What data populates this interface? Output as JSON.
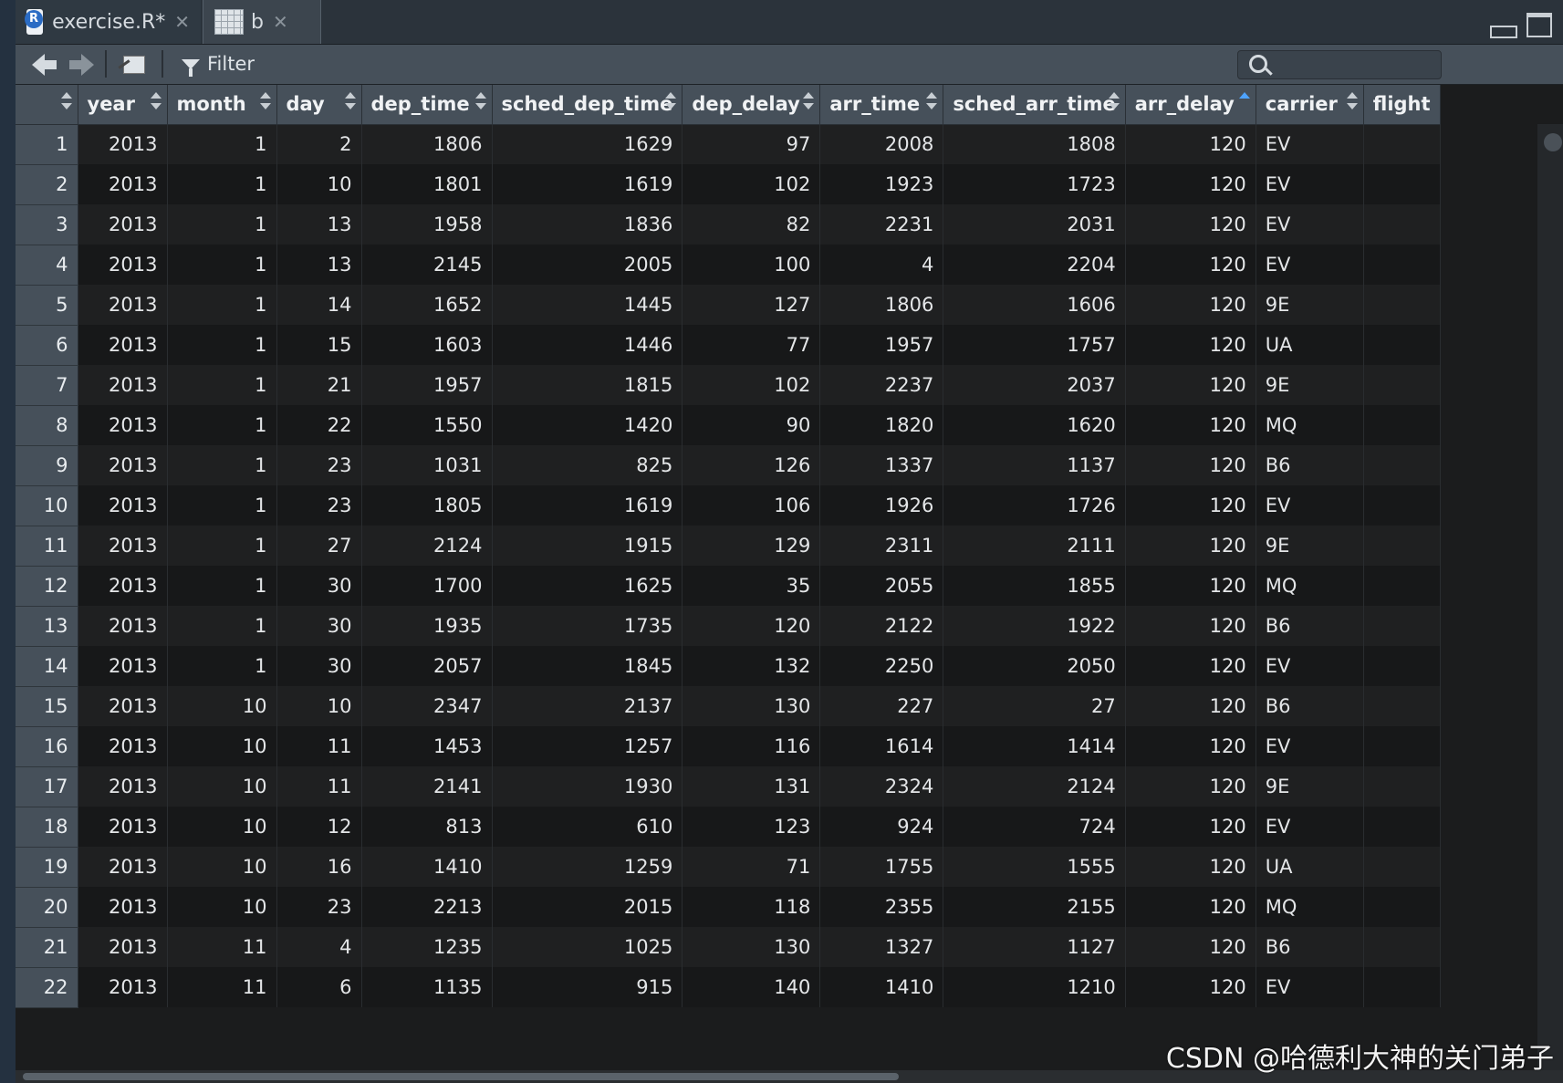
{
  "tabs": [
    {
      "label": "exercise.R*",
      "icon": "r-file-icon"
    },
    {
      "label": "b",
      "icon": "data-grid-icon"
    }
  ],
  "toolbar": {
    "filter_label": "Filter",
    "search_placeholder": ""
  },
  "table": {
    "columns": [
      "",
      "year",
      "month",
      "day",
      "dep_time",
      "sched_dep_time",
      "dep_delay",
      "arr_time",
      "sched_arr_time",
      "arr_delay",
      "carrier",
      "flight"
    ],
    "sorted_column": "arr_delay",
    "rows": [
      [
        "1",
        "2013",
        "1",
        "2",
        "1806",
        "1629",
        "97",
        "2008",
        "1808",
        "120",
        "EV",
        ""
      ],
      [
        "2",
        "2013",
        "1",
        "10",
        "1801",
        "1619",
        "102",
        "1923",
        "1723",
        "120",
        "EV",
        ""
      ],
      [
        "3",
        "2013",
        "1",
        "13",
        "1958",
        "1836",
        "82",
        "2231",
        "2031",
        "120",
        "EV",
        ""
      ],
      [
        "4",
        "2013",
        "1",
        "13",
        "2145",
        "2005",
        "100",
        "4",
        "2204",
        "120",
        "EV",
        ""
      ],
      [
        "5",
        "2013",
        "1",
        "14",
        "1652",
        "1445",
        "127",
        "1806",
        "1606",
        "120",
        "9E",
        ""
      ],
      [
        "6",
        "2013",
        "1",
        "15",
        "1603",
        "1446",
        "77",
        "1957",
        "1757",
        "120",
        "UA",
        ""
      ],
      [
        "7",
        "2013",
        "1",
        "21",
        "1957",
        "1815",
        "102",
        "2237",
        "2037",
        "120",
        "9E",
        ""
      ],
      [
        "8",
        "2013",
        "1",
        "22",
        "1550",
        "1420",
        "90",
        "1820",
        "1620",
        "120",
        "MQ",
        ""
      ],
      [
        "9",
        "2013",
        "1",
        "23",
        "1031",
        "825",
        "126",
        "1337",
        "1137",
        "120",
        "B6",
        ""
      ],
      [
        "10",
        "2013",
        "1",
        "23",
        "1805",
        "1619",
        "106",
        "1926",
        "1726",
        "120",
        "EV",
        ""
      ],
      [
        "11",
        "2013",
        "1",
        "27",
        "2124",
        "1915",
        "129",
        "2311",
        "2111",
        "120",
        "9E",
        ""
      ],
      [
        "12",
        "2013",
        "1",
        "30",
        "1700",
        "1625",
        "35",
        "2055",
        "1855",
        "120",
        "MQ",
        ""
      ],
      [
        "13",
        "2013",
        "1",
        "30",
        "1935",
        "1735",
        "120",
        "2122",
        "1922",
        "120",
        "B6",
        ""
      ],
      [
        "14",
        "2013",
        "1",
        "30",
        "2057",
        "1845",
        "132",
        "2250",
        "2050",
        "120",
        "EV",
        ""
      ],
      [
        "15",
        "2013",
        "10",
        "10",
        "2347",
        "2137",
        "130",
        "227",
        "27",
        "120",
        "B6",
        ""
      ],
      [
        "16",
        "2013",
        "10",
        "11",
        "1453",
        "1257",
        "116",
        "1614",
        "1414",
        "120",
        "EV",
        ""
      ],
      [
        "17",
        "2013",
        "10",
        "11",
        "2141",
        "1930",
        "131",
        "2324",
        "2124",
        "120",
        "9E",
        ""
      ],
      [
        "18",
        "2013",
        "10",
        "12",
        "813",
        "610",
        "123",
        "924",
        "724",
        "120",
        "EV",
        ""
      ],
      [
        "19",
        "2013",
        "10",
        "16",
        "1410",
        "1259",
        "71",
        "1755",
        "1555",
        "120",
        "UA",
        ""
      ],
      [
        "20",
        "2013",
        "10",
        "23",
        "2213",
        "2015",
        "118",
        "2355",
        "2155",
        "120",
        "MQ",
        ""
      ],
      [
        "21",
        "2013",
        "11",
        "4",
        "1235",
        "1025",
        "130",
        "1327",
        "1127",
        "120",
        "B6",
        ""
      ],
      [
        "22",
        "2013",
        "11",
        "6",
        "1135",
        "915",
        "140",
        "1410",
        "1210",
        "120",
        "EV",
        ""
      ]
    ]
  },
  "watermark": "CSDN @哈德利大神的关门弟子"
}
